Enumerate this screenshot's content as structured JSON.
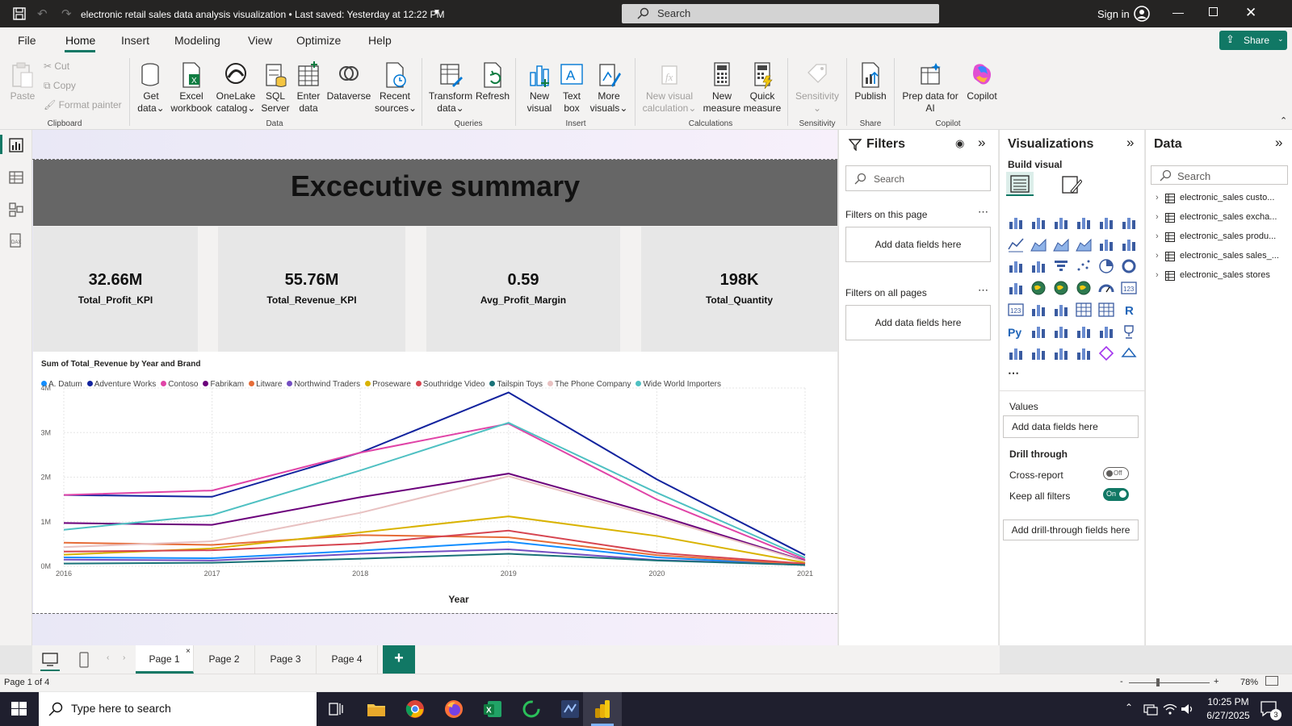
{
  "app": {
    "title": "electronic retail sales data analysis visualization • Last saved: Yesterday at 12:22 PM",
    "search_placeholder": "Search",
    "sign_in": "Sign in",
    "share": "Share"
  },
  "menu": [
    "File",
    "Home",
    "Insert",
    "Modeling",
    "View",
    "Optimize",
    "Help"
  ],
  "ribbon": {
    "clipboard": {
      "paste": "Paste",
      "cut": "Cut",
      "copy": "Copy",
      "format_painter": "Format painter",
      "label": "Clipboard"
    },
    "data": {
      "get_data": [
        "Get",
        "data"
      ],
      "excel": [
        "Excel",
        "workbook"
      ],
      "onelake": [
        "OneLake",
        "catalog"
      ],
      "sql": [
        "SQL",
        "Server"
      ],
      "enter": [
        "Enter",
        "data"
      ],
      "dataverse": "Dataverse",
      "recent": [
        "Recent",
        "sources"
      ],
      "label": "Data"
    },
    "queries": {
      "transform": [
        "Transform",
        "data"
      ],
      "refresh": "Refresh",
      "label": "Queries"
    },
    "insert": {
      "new_visual": [
        "New",
        "visual"
      ],
      "text_box": [
        "Text",
        "box"
      ],
      "more_visuals": [
        "More",
        "visuals"
      ],
      "label": "Insert"
    },
    "calculations": {
      "new_visual_calc": [
        "New visual",
        "calculation"
      ],
      "new_measure": [
        "New",
        "measure"
      ],
      "quick_measure": [
        "Quick",
        "measure"
      ],
      "label": "Calculations"
    },
    "sensitivity": {
      "sensitivity": "Sensitivity",
      "label": "Sensitivity"
    },
    "share": {
      "publish": "Publish",
      "label": "Share"
    },
    "copilot": {
      "prep": [
        "Prep data for",
        "AI"
      ],
      "copilot": "Copilot",
      "label": "Copilot"
    }
  },
  "report": {
    "title": "Excecutive summary",
    "kpis": [
      {
        "value": "32.66M",
        "label": "Total_Profit_KPI"
      },
      {
        "value": "55.76M",
        "label": "Total_Revenue_KPI"
      },
      {
        "value": "0.59",
        "label": "Avg_Profit_Margin"
      },
      {
        "value": "198K",
        "label": "Total_Quantity"
      }
    ]
  },
  "chart_data": {
    "type": "line",
    "title": "Sum of Total_Revenue by Year and Brand",
    "xlabel": "Year",
    "ylabel": "",
    "x": [
      2016,
      2017,
      2018,
      2019,
      2020,
      2021
    ],
    "ylim": [
      0,
      4000000
    ],
    "yticks": [
      "0M",
      "1M",
      "2M",
      "3M",
      "4M"
    ],
    "grid": true,
    "legend": "top-left",
    "series": [
      {
        "name": "A. Datum",
        "color": "#118dff",
        "values": [
          200000,
          180000,
          350000,
          550000,
          200000,
          30000
        ]
      },
      {
        "name": "Adventure Works",
        "color": "#12239e",
        "values": [
          1600000,
          1560000,
          2550000,
          3900000,
          1950000,
          250000
        ]
      },
      {
        "name": "Contoso",
        "color": "#e044a7",
        "values": [
          1600000,
          1700000,
          2550000,
          3200000,
          1500000,
          150000
        ]
      },
      {
        "name": "Fabrikam",
        "color": "#6b007b",
        "values": [
          970000,
          930000,
          1550000,
          2080000,
          1150000,
          120000
        ]
      },
      {
        "name": "Litware",
        "color": "#e66c37",
        "values": [
          530000,
          480000,
          700000,
          650000,
          250000,
          40000
        ]
      },
      {
        "name": "Northwind Traders",
        "color": "#744ec2",
        "values": [
          150000,
          130000,
          280000,
          380000,
          140000,
          30000
        ]
      },
      {
        "name": "Proseware",
        "color": "#d9b300",
        "values": [
          260000,
          400000,
          760000,
          1120000,
          680000,
          80000
        ]
      },
      {
        "name": "Southridge Video",
        "color": "#d64550",
        "values": [
          330000,
          360000,
          510000,
          800000,
          300000,
          60000
        ]
      },
      {
        "name": "Tailspin Toys",
        "color": "#197278",
        "values": [
          60000,
          80000,
          170000,
          280000,
          130000,
          30000
        ]
      },
      {
        "name": "The Phone Company",
        "color": "#e8c1c1",
        "values": [
          430000,
          560000,
          1200000,
          2020000,
          1100000,
          110000
        ]
      },
      {
        "name": "Wide World Importers",
        "color": "#4ec0c2",
        "values": [
          820000,
          1150000,
          2150000,
          3220000,
          1650000,
          190000
        ]
      }
    ]
  },
  "filters": {
    "title": "Filters",
    "search": "Search",
    "on_page": "Filters on this page",
    "on_all": "Filters on all pages",
    "add_fields": "Add data fields here"
  },
  "visualizations": {
    "title": "Visualizations",
    "build": "Build visual",
    "values": "Values",
    "add_fields": "Add data fields here",
    "drill": "Drill through",
    "cross_report": "Cross-report",
    "cross_state": "Off",
    "keep_filters": "Keep all filters",
    "keep_state": "On",
    "add_drill": "Add drill-through fields here"
  },
  "data_pane": {
    "title": "Data",
    "search": "Search",
    "tables": [
      "electronic_sales custo...",
      "electronic_sales excha...",
      "electronic_sales produ...",
      "electronic_sales sales_...",
      "electronic_sales stores"
    ]
  },
  "pages": [
    "Page 1",
    "Page 2",
    "Page 3",
    "Page 4"
  ],
  "status": {
    "page": "Page 1 of 4",
    "zoom": "78%"
  },
  "taskbar": {
    "search": "Type here to search",
    "time": "10:25 PM",
    "date": "6/27/2025",
    "notif": "3"
  }
}
